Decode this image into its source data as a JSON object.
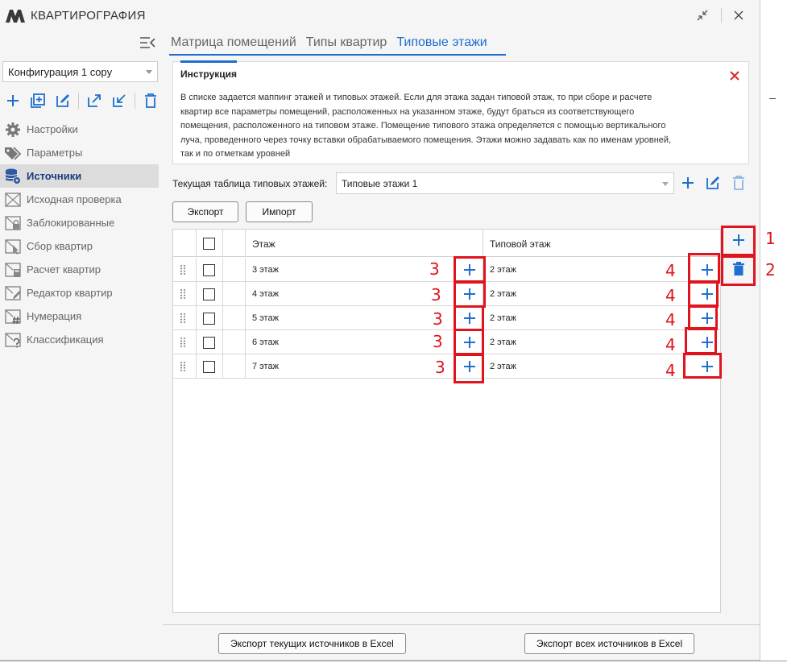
{
  "window": {
    "title": "КВАРТИРОГРАФИЯ"
  },
  "sidebar": {
    "config_value": "Конфигурация 1 copy",
    "toolbar_icons": [
      "plus-icon",
      "add-copy-icon",
      "edit-icon",
      "export-icon",
      "import-icon",
      "trash-icon"
    ],
    "items": [
      {
        "label": "Настройки",
        "icon": "gear-icon"
      },
      {
        "label": "Параметры",
        "icon": "tags-icon"
      },
      {
        "label": "Источники",
        "icon": "database-icon"
      },
      {
        "label": "Исходная проверка",
        "icon": "envelope-icon"
      },
      {
        "label": "Заблокированные",
        "icon": "lock-icon"
      },
      {
        "label": "Сбор квартир",
        "icon": "cursor-icon"
      },
      {
        "label": "Расчет квартир",
        "icon": "calculator-icon"
      },
      {
        "label": "Редактор квартир",
        "icon": "pencil-icon"
      },
      {
        "label": "Нумерация",
        "icon": "hash-icon"
      },
      {
        "label": "Классификация",
        "icon": "question-icon"
      }
    ]
  },
  "tabs": [
    {
      "label": "Матрица помещений"
    },
    {
      "label": "Типы квартир"
    },
    {
      "label": "Типовые этажи"
    }
  ],
  "instruction": {
    "title": "Инструкция",
    "lines": [
      "В списке задается маппинг этажей и типовых этажей. Если для этажа задан типовой этаж, то при сборе и расчете",
      "квартир все параметры помещений, расположенных на указанном этаже, будут браться из соответствующего",
      "помещения, расположенного на типовом этаже. Помещение типового этажа определяется с помощью вертикального",
      "луча, проведенного через точку вставки обрабатываемого помещения. Этажи можно задавать как по именам уровней,",
      "так и по отметкам уровней"
    ]
  },
  "current_table": {
    "label": "Текущая таблица типовых этажей:",
    "value": "Типовые этажи 1"
  },
  "buttons": {
    "export": "Экспорт",
    "import": "Импорт",
    "export_current": "Экспорт текущих источников в Excel",
    "export_all": "Экспорт всех источников в Excel"
  },
  "grid": {
    "headers": {
      "floor": "Этаж",
      "typical": "Типовой этаж"
    },
    "rows": [
      {
        "floor": "3 этаж",
        "typical": "2 этаж"
      },
      {
        "floor": "4 этаж",
        "typical": "2 этаж"
      },
      {
        "floor": "5 этаж",
        "typical": "2 этаж"
      },
      {
        "floor": "6 этаж",
        "typical": "2 этаж"
      },
      {
        "floor": "7 этаж",
        "typical": "2 этаж"
      }
    ]
  },
  "annotations": {
    "a1": "1",
    "a2": "2",
    "a3": "3",
    "a4": "4"
  },
  "colors": {
    "accent": "#1e6fcf",
    "annotation": "#e0141e",
    "close_x": "#d62b2b"
  }
}
